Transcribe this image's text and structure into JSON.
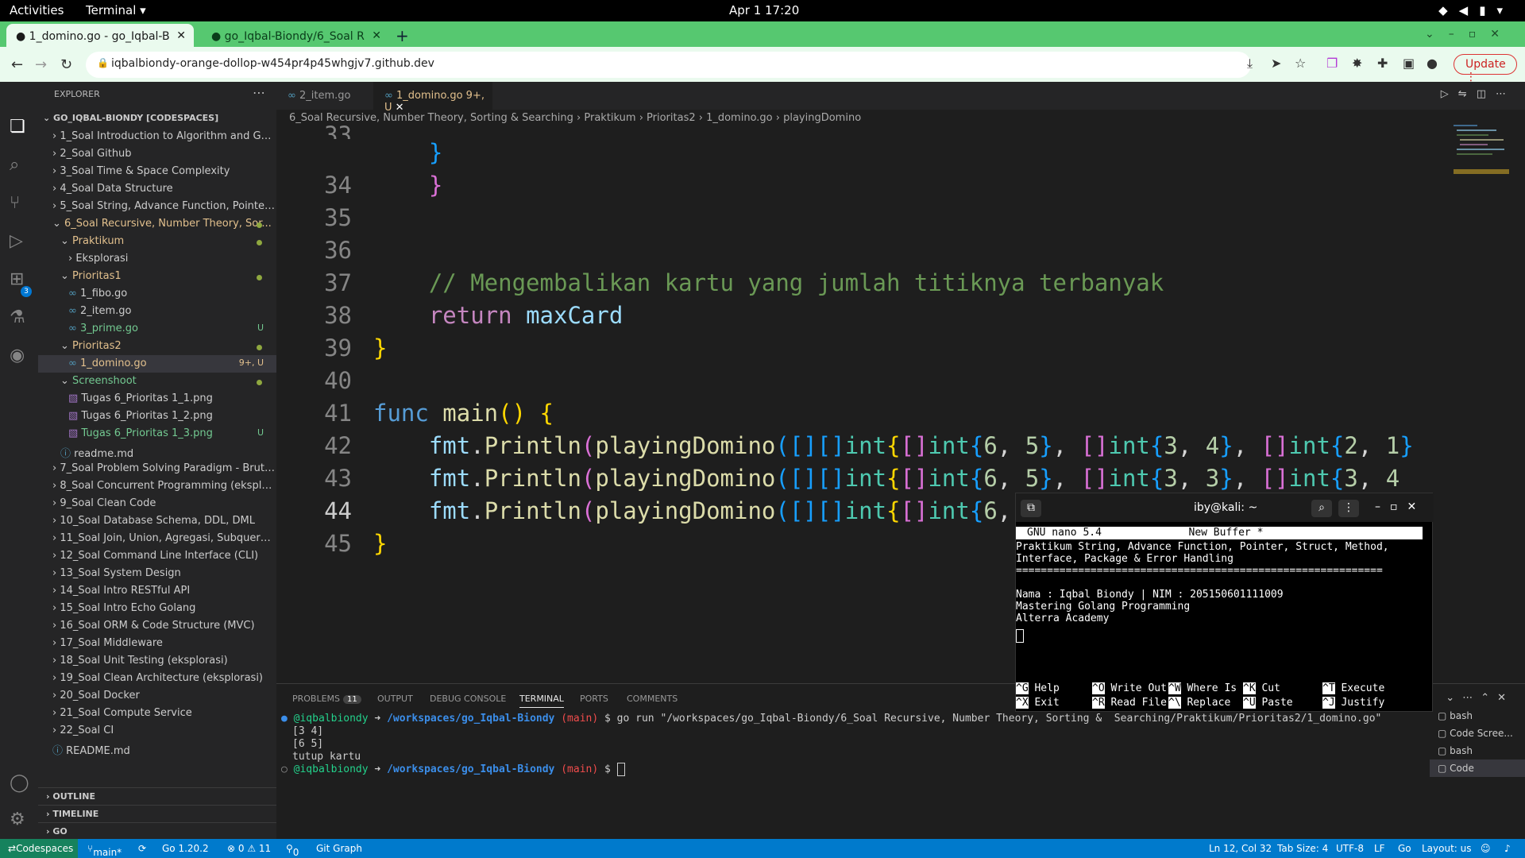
{
  "gnome": {
    "activities": "Activities",
    "app": "Terminal ▾",
    "clock": "Apr 1  17:20"
  },
  "browser": {
    "tabs": [
      {
        "label": "1_domino.go - go_Iqbal-B"
      },
      {
        "label": "go_Iqbal-Biondy/6_Soal R"
      }
    ],
    "url": "iqbalbiondy-orange-dollop-w454pr4p45whgjv7.github.dev",
    "update": "Update"
  },
  "explorer": {
    "header": "EXPLORER",
    "root": "GO_IQBAL-BIONDY [CODESPACES]",
    "items": [
      {
        "label": "1_Soal Introduction to Algorithm and Golang"
      },
      {
        "label": "2_Soal Github"
      },
      {
        "label": "3_Soal Time & Space Complexity"
      },
      {
        "label": "4_Soal Data Structure"
      },
      {
        "label": "5_Soal String, Advance Function, Pointer, St..."
      },
      {
        "label": "6_Soal Recursive, Number Theory, Sor..."
      },
      {
        "label": "Praktikum"
      },
      {
        "label": "Eksplorasi"
      },
      {
        "label": "Prioritas1"
      },
      {
        "label": "1_fibo.go"
      },
      {
        "label": "2_item.go"
      },
      {
        "label": "3_prime.go",
        "deco": "U"
      },
      {
        "label": "Prioritas2"
      },
      {
        "label": "1_domino.go",
        "deco": "9+, U"
      },
      {
        "label": "Screenshoot"
      },
      {
        "label": "Tugas 6_Prioritas 1_1.png"
      },
      {
        "label": "Tugas 6_Prioritas 1_2.png"
      },
      {
        "label": "Tugas 6_Prioritas 1_3.png",
        "deco": "U"
      },
      {
        "label": "readme.md"
      },
      {
        "label": "7_Soal Problem Solving Paradigm - Brute F..."
      },
      {
        "label": "8_Soal Concurrent Programming (eksplorasi)"
      },
      {
        "label": "9_Soal Clean Code"
      },
      {
        "label": "10_Soal Database Schema, DDL, DML"
      },
      {
        "label": "11_Soal Join, Union, Agregasi, Subquery, Fu..."
      },
      {
        "label": "12_Soal Command Line Interface (CLI)"
      },
      {
        "label": "13_Soal System Design"
      },
      {
        "label": "14_Soal Intro RESTful API"
      },
      {
        "label": "15_Soal Intro Echo Golang"
      },
      {
        "label": "16_Soal ORM & Code Structure (MVC)"
      },
      {
        "label": "17_Soal Middleware"
      },
      {
        "label": "18_Soal Unit Testing (eksplorasi)"
      },
      {
        "label": "19_Soal Clean Architecture (eksplorasi)"
      },
      {
        "label": "20_Soal Docker"
      },
      {
        "label": "21_Soal Compute Service"
      },
      {
        "label": "22_Soal CI"
      },
      {
        "label": "README.md"
      }
    ],
    "outline": "OUTLINE",
    "timeline": "TIMELINE",
    "go": "GO"
  },
  "editor": {
    "tabs": [
      {
        "label": "2_item.go"
      },
      {
        "label": "1_domino.go",
        "deco": "9+, U"
      }
    ],
    "crumbs": "6_Soal Recursive, Number Theory, Sorting &  Searching  ›  Praktikum  ›  Prioritas2  ›  1_domino.go  ›  playingDomino",
    "lines": [
      "33",
      "34",
      "35",
      "36",
      "37",
      "38",
      "39",
      "40",
      "41",
      "42",
      "43",
      "44",
      "45"
    ],
    "code": {
      "l36": "// Mengembalikan kartu yang jumlah titiknya terbanyak",
      "l37a": "return",
      "l37b": " maxCard",
      "l40a": "func",
      "l40b": " main",
      "l40c": "() {"
    }
  },
  "panel": {
    "tabs": [
      "PROBLEMS",
      "OUTPUT",
      "DEBUG CONSOLE",
      "TERMINAL",
      "PORTS",
      "COMMENTS"
    ],
    "problems_count": "11",
    "user": "@iqbalbiondy",
    "arrow": " ➜ ",
    "path": "/workspaces/go_Iqbal-Biondy",
    "branch": " (main)",
    "cmd": " $ go run \"/workspaces/go_Iqbal-Biondy/6_Soal Recursive, Number Theory, Sorting &  Searching/Praktikum/Prioritas2/1_domino.go\"",
    "out1": "[3 4]",
    "out2": "[6 5]",
    "out3": "tutup kartu",
    "prompt": " $ ",
    "terminals": [
      "bash",
      "Code Scree...",
      "bash",
      "Code"
    ]
  },
  "nano": {
    "title": "iby@kali: ~",
    "header": "GNU nano 5.4              New Buffer *",
    "body": [
      "Praktikum String, Advance Function, Pointer, Struct, Method,",
      "Interface, Package & Error Handling",
      "===========================================================",
      "",
      "Nama : Iqbal Biondy | NIM : 205150601111009",
      "Mastering Golang Programming",
      "Alterra Academy"
    ],
    "shortcuts": [
      {
        "key": "^G",
        "label": "Help"
      },
      {
        "key": "^O",
        "label": "Write Out"
      },
      {
        "key": "^W",
        "label": "Where Is"
      },
      {
        "key": "^K",
        "label": "Cut"
      },
      {
        "key": "^T",
        "label": "Execute"
      },
      {
        "key": "^X",
        "label": "Exit"
      },
      {
        "key": "^R",
        "label": "Read File"
      },
      {
        "key": "^\\",
        "label": "Replace"
      },
      {
        "key": "^U",
        "label": "Paste"
      },
      {
        "key": "^J",
        "label": "Justify"
      }
    ]
  },
  "status": {
    "remote": "Codespaces",
    "branch": "main*",
    "go": "Go 1.20.2",
    "errors": "⊗ 0 ⚠ 11",
    "ports": "0",
    "gitgraph": "Git Graph",
    "pos": "Ln 12, Col 32",
    "tab": "Tab Size: 4",
    "enc": "UTF-8",
    "eol": "LF",
    "lang": "Go",
    "layout": "Layout: us"
  }
}
